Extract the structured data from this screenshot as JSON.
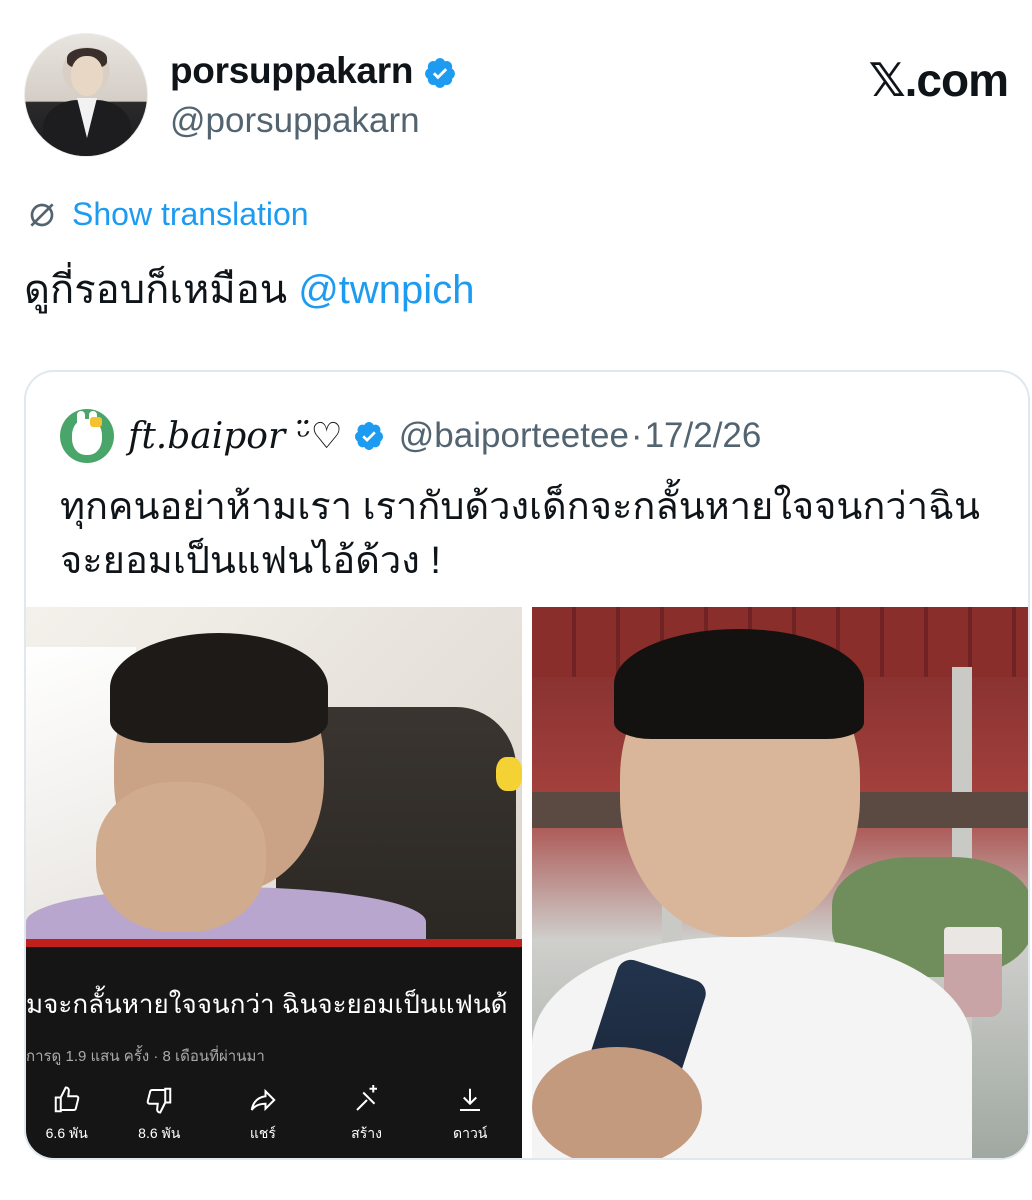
{
  "post": {
    "display_name": "porsuppakarn",
    "handle": "@porsuppakarn",
    "brand": "𝕏.com",
    "translate_label": "Show translation",
    "text": "ดูกี่รอบก็เหมือน ",
    "mention": "@twnpich"
  },
  "quote": {
    "display_name": "ft.baipor ᵕ̈♡",
    "handle": "@baiporteetee",
    "separator": "·",
    "date": "17/2/26",
    "text": "ทุกคนอย่าห้ามเรา เรากับด้วงเด็กจะกลั้นหายใจจนกว่าฉินจะยอมเป็นแฟนไอ้ด้วง !"
  },
  "media_left": {
    "video_title": "มจะกลั้นหายใจจนกว่า ฉินจะยอมเป็นแฟนด้",
    "video_meta": "การดู 1.9 แสน ครั้ง · 8 เดือนที่ผ่านมา",
    "actions": [
      {
        "icon": "thumbs-up-icon",
        "label": "6.6 พัน"
      },
      {
        "icon": "thumbs-down-icon",
        "label": "8.6 พัน"
      },
      {
        "icon": "share-icon",
        "label": "แชร์"
      },
      {
        "icon": "create-icon",
        "label": "สร้าง"
      },
      {
        "icon": "download-icon",
        "label": "ดาวน์"
      }
    ]
  },
  "colors": {
    "accent": "#1d9bf0",
    "secondary_text": "#536471"
  }
}
